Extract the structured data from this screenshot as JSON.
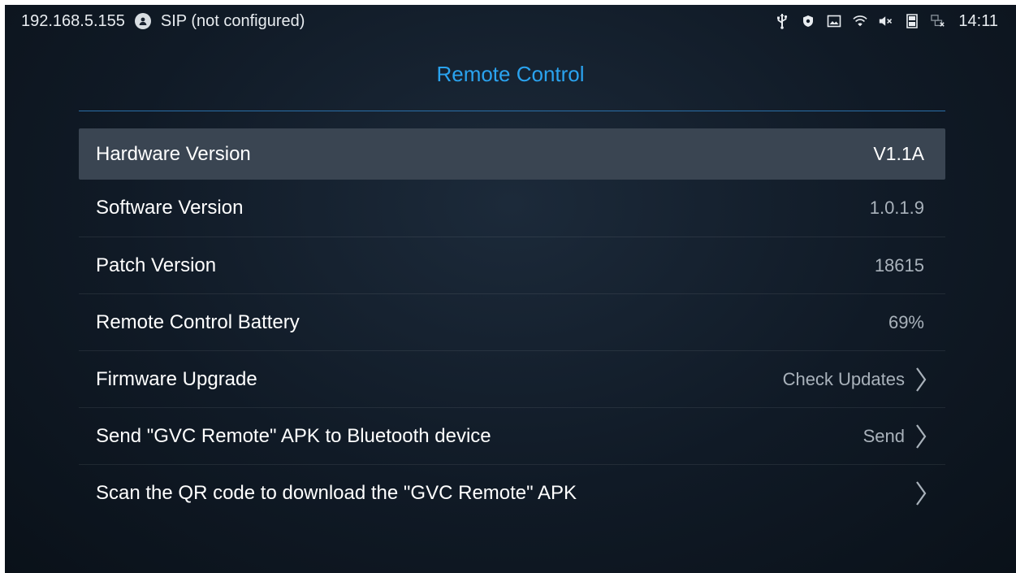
{
  "status_bar": {
    "ip": "192.168.5.155",
    "sip_status": "SIP (not configured)",
    "time": "14:11",
    "icons": [
      "usb-icon",
      "shield-icon",
      "image-icon",
      "wifi-icon",
      "volume-muted-icon",
      "sd-card-icon",
      "ethernet-disconnected-icon"
    ]
  },
  "page": {
    "title": "Remote Control"
  },
  "items": [
    {
      "label": "Hardware Version",
      "value": "V1.1A",
      "chevron": false,
      "selected": true
    },
    {
      "label": "Software Version",
      "value": "1.0.1.9",
      "chevron": false
    },
    {
      "label": "Patch Version",
      "value": "18615",
      "chevron": false
    },
    {
      "label": "Remote Control Battery",
      "value": "69%",
      "chevron": false
    },
    {
      "label": "Firmware Upgrade",
      "value": "Check Updates",
      "chevron": true
    },
    {
      "label": "Send \"GVC Remote\" APK to Bluetooth device",
      "value": "Send",
      "chevron": true
    },
    {
      "label": "Scan the QR code to download the \"GVC Remote\" APK",
      "value": "",
      "chevron": true
    }
  ],
  "colors": {
    "accent": "#2aa3ef",
    "selected_row": "#3a4552",
    "value_text": "#a9b2bb"
  }
}
